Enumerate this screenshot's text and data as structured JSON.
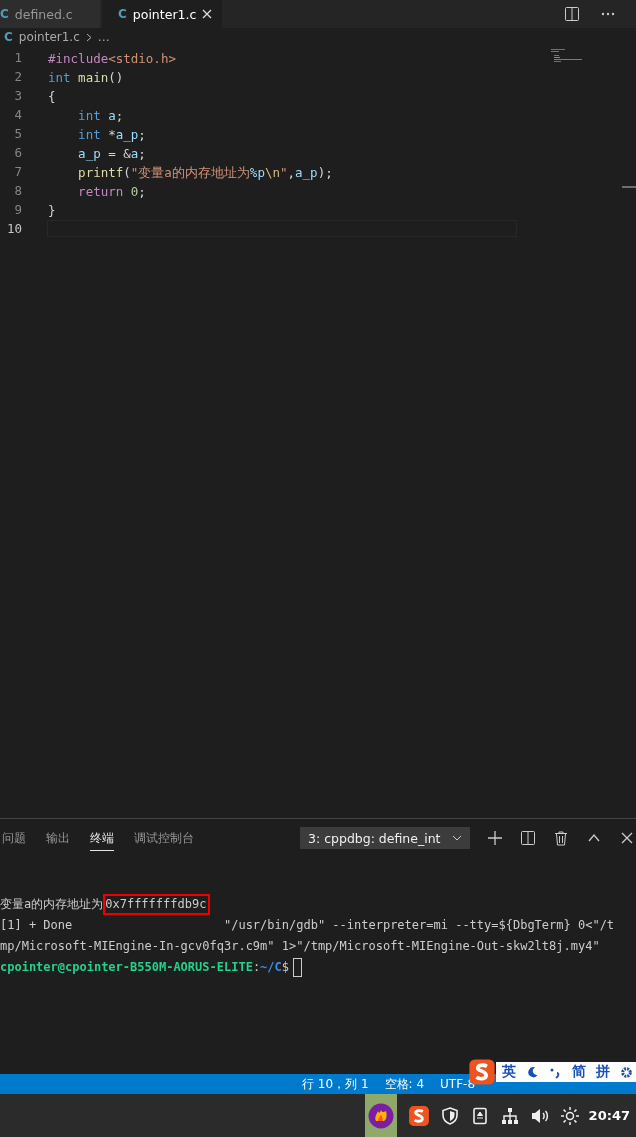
{
  "tabs": [
    {
      "icon": "C",
      "label": "defined.c",
      "selected": false,
      "closable": false
    },
    {
      "icon": "C",
      "label": "pointer1.c",
      "selected": true,
      "closable": true
    }
  ],
  "breadcrumb": {
    "icon": "C",
    "file": "pointer1.c",
    "rest": "…"
  },
  "editor": {
    "lines": [
      {
        "number": "1",
        "current": false,
        "tokens": [
          {
            "kind": "preproc",
            "text": "#include"
          },
          {
            "kind": "string",
            "text": "<stdio.h>"
          }
        ]
      },
      {
        "number": "2",
        "current": false,
        "tokens": [
          {
            "kind": "keyword",
            "text": "int"
          },
          {
            "kind": "func",
            "text": " main"
          },
          {
            "kind": "plain",
            "text": "()"
          }
        ]
      },
      {
        "number": "3",
        "current": false,
        "tokens": [
          {
            "kind": "plain",
            "text": "{"
          }
        ]
      },
      {
        "number": "4",
        "current": false,
        "tokens": [
          {
            "kind": "keyword",
            "text": "    int"
          },
          {
            "kind": "var",
            "text": " a"
          },
          {
            "kind": "plain",
            "text": ";"
          }
        ]
      },
      {
        "number": "5",
        "current": false,
        "tokens": [
          {
            "kind": "keyword",
            "text": "    int"
          },
          {
            "kind": "plain",
            "text": " *"
          },
          {
            "kind": "var",
            "text": "a_p"
          },
          {
            "kind": "plain",
            "text": ";"
          }
        ]
      },
      {
        "number": "6",
        "current": false,
        "tokens": [
          {
            "kind": "var",
            "text": "    a_p"
          },
          {
            "kind": "plain",
            "text": " = &"
          },
          {
            "kind": "var",
            "text": "a"
          },
          {
            "kind": "plain",
            "text": ";"
          }
        ]
      },
      {
        "number": "7",
        "current": false,
        "tokens": [
          {
            "kind": "func",
            "text": "    printf"
          },
          {
            "kind": "plain",
            "text": "("
          },
          {
            "kind": "string",
            "text": "\"变量a的内存地址为"
          },
          {
            "kind": "var",
            "text": "%p"
          },
          {
            "kind": "escape",
            "text": "\\n"
          },
          {
            "kind": "string",
            "text": "\""
          },
          {
            "kind": "plain",
            "text": ","
          },
          {
            "kind": "var",
            "text": "a_p"
          },
          {
            "kind": "plain",
            "text": ");"
          }
        ]
      },
      {
        "number": "8",
        "current": false,
        "tokens": [
          {
            "kind": "control",
            "text": "    return"
          },
          {
            "kind": "number",
            "text": " 0"
          },
          {
            "kind": "plain",
            "text": ";"
          }
        ]
      },
      {
        "number": "9",
        "current": false,
        "tokens": [
          {
            "kind": "plain",
            "text": "}"
          }
        ]
      },
      {
        "number": "10",
        "current": true
      }
    ]
  },
  "panel": {
    "tabs": [
      {
        "label": "问题",
        "selected": false
      },
      {
        "label": "输出",
        "selected": false
      },
      {
        "label": "终端",
        "selected": true
      },
      {
        "label": "调试控制台",
        "selected": false
      }
    ],
    "terminal_select": "3: cppdbg: define_int",
    "terminal": [
      {
        "kind": "output",
        "text": "变量a的内存地址为",
        "highlight": "0x7fffffffdb9c"
      },
      {
        "kind": "plain",
        "text": "[1] + Done                     \"/usr/bin/gdb\" --interpreter=mi --tty=${DbgTerm} 0<\"/t"
      },
      {
        "kind": "plain",
        "text": "mp/Microsoft-MIEngine-In-gcv0fq3r.c9m\" 1>\"/tmp/Microsoft-MIEngine-Out-skw2lt8j.my4\""
      },
      {
        "kind": "prompt",
        "user": "cpointer@cpointer-B550M-AORUS-ELITE",
        "sep": ":",
        "path": "~/C",
        "symbol": "$"
      }
    ]
  },
  "status_bar": [
    "行 10，列 1",
    "空格: 4",
    "UTF-8"
  ],
  "ime": {
    "mode": "英",
    "chars": [
      "简",
      "拼"
    ]
  },
  "taskbar": {
    "clock": "20:47"
  }
}
